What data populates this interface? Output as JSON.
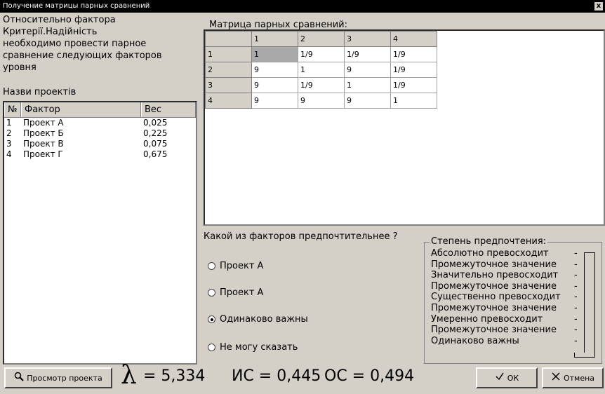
{
  "window": {
    "title": "Получение матрицы парных сравнений",
    "close_label": "x"
  },
  "left_description": {
    "lines": [
      "Относительно фактора",
      "Критерії.Надійність",
      "необходимо провести парное",
      "сравнение следующих факторов",
      "уровня"
    ],
    "projects_caption": "Назви проектів"
  },
  "factors_table": {
    "headers": [
      "№",
      "Фактор",
      "Вес"
    ],
    "rows": [
      {
        "no": "1",
        "name": "Проект А",
        "weight": "0,025"
      },
      {
        "no": "2",
        "name": "Проект Б",
        "weight": "0,225"
      },
      {
        "no": "3",
        "name": "Проект В",
        "weight": "0,075"
      },
      {
        "no": "4",
        "name": "Проект Г",
        "weight": "0,675"
      }
    ]
  },
  "matrix": {
    "caption": "Матрица парных сравнений:",
    "col_headers": [
      "",
      "1",
      "2",
      "3",
      "4"
    ],
    "rows": [
      [
        "1",
        "1",
        "1/9",
        "1/9",
        "1/9"
      ],
      [
        "2",
        "9",
        "1",
        "9",
        "1/9"
      ],
      [
        "3",
        "9",
        "1/9",
        "1",
        "1/9"
      ],
      [
        "4",
        "9",
        "9",
        "9",
        "1"
      ]
    ]
  },
  "question": {
    "text": "Какой из факторов предпочтительнее ?",
    "options": [
      "Проект А",
      "Проект А",
      "Одинаково важны",
      "Не могу сказать"
    ],
    "selected_index": 2
  },
  "preference": {
    "caption": "Степень предпочтения:",
    "levels": [
      "Абсолютно превосходит",
      "Промежуточное значение",
      "Значительно превосходит",
      "Промежуточное значение",
      "Существенно превосходит",
      "Промежуточное значение",
      "Умеренно превосходит",
      "Промежуточное значение",
      "Одинаково важны"
    ],
    "dash": "-"
  },
  "footer": {
    "view_button": "Просмотр проекта",
    "lambda_symbol": "λ",
    "lambda_value": "= 5,334",
    "ic_text": "ИС = 0,445",
    "oc_text": "ОС = 0,494",
    "ok_label": "ОК",
    "cancel_label": "Отмена"
  },
  "icons": {
    "search": "search-icon",
    "check": "check-icon",
    "close": "close-icon"
  }
}
